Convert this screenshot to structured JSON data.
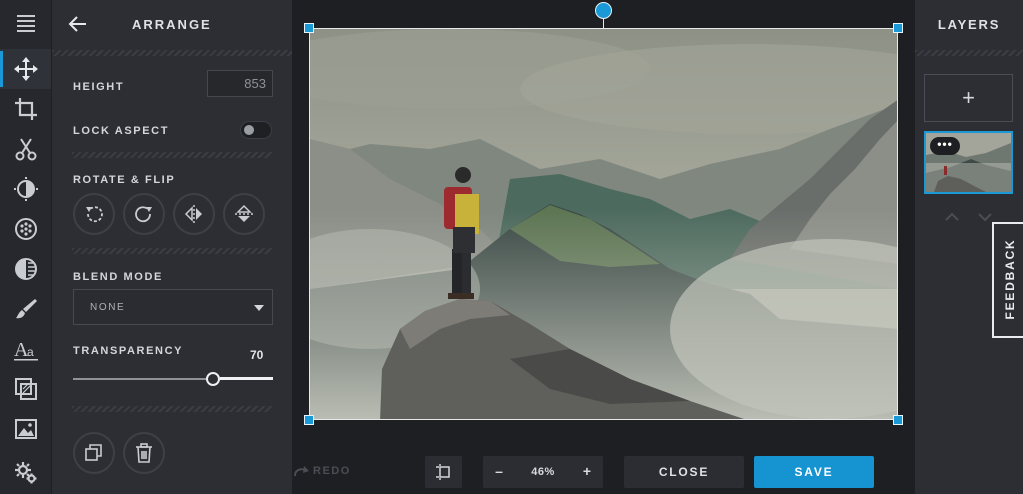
{
  "rail": {
    "items": [
      {
        "name": "menu-icon"
      },
      {
        "name": "move-icon"
      },
      {
        "name": "crop-icon"
      },
      {
        "name": "scissors-icon"
      },
      {
        "name": "adjust-icon"
      },
      {
        "name": "filters-icon"
      },
      {
        "name": "effects-icon"
      },
      {
        "name": "brush-icon"
      },
      {
        "name": "text-icon"
      },
      {
        "name": "overlay-icon"
      },
      {
        "name": "image-icon"
      },
      {
        "name": "settings-icon"
      }
    ],
    "active": "move-icon",
    "accent": "#1a99d6"
  },
  "panel": {
    "title": "ARRANGE",
    "height_label": "HEIGHT",
    "height_value": "853",
    "lock_aspect_label": "LOCK ASPECT",
    "lock_aspect_on": false,
    "rotate_flip_label": "ROTATE & FLIP",
    "rotate_buttons": [
      "rotate-left-icon",
      "rotate-right-icon",
      "flip-horizontal-icon",
      "flip-vertical-icon"
    ],
    "blend_mode_label": "BLEND MODE",
    "blend_mode_value": "NONE",
    "transparency_label": "TRANSPARENCY",
    "transparency_value": "70",
    "transparency_fraction": 0.7,
    "action_buttons": [
      "duplicate-icon",
      "trash-icon"
    ]
  },
  "toolbar": {
    "redo_label": "REDO",
    "zoom_minus": "–",
    "zoom_value": "46%",
    "zoom_plus": "+",
    "close_label": "CLOSE",
    "save_label": "SAVE",
    "save_color": "#1594d1"
  },
  "layers": {
    "title": "LAYERS",
    "add_label": "+",
    "layer_menu_label": "•••",
    "feedback_label": "FEEDBACK"
  }
}
